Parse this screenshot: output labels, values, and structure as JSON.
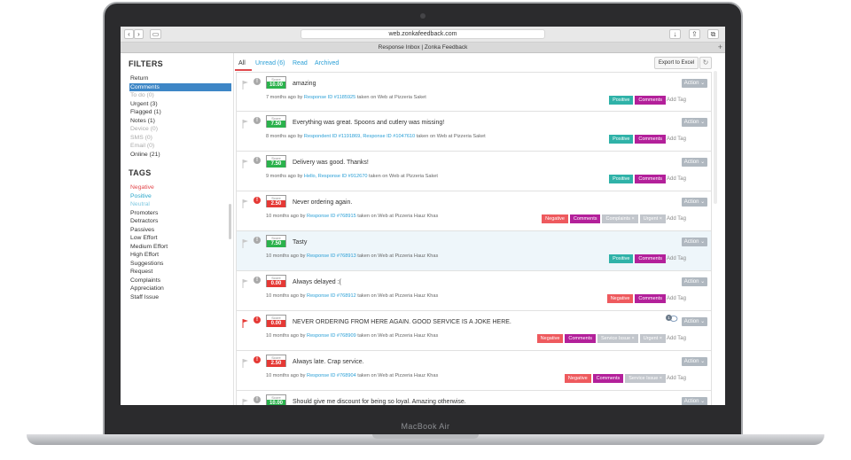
{
  "device": {
    "label": "MacBook Air"
  },
  "browser": {
    "url": "web.zonkafeedback.com",
    "tab_title": "Response Inbox | Zonka Feedback"
  },
  "sidebar": {
    "filters_title": "FILTERS",
    "filters": [
      {
        "label": "Return",
        "state": "normal"
      },
      {
        "label": "Comments",
        "state": "selected"
      },
      {
        "label": "To do (0)",
        "state": "dim"
      },
      {
        "label": "Urgent (3)",
        "state": "normal"
      },
      {
        "label": "Flagged (1)",
        "state": "normal"
      },
      {
        "label": "Notes (1)",
        "state": "normal"
      },
      {
        "label": "Device (0)",
        "state": "dim"
      },
      {
        "label": "SMS (0)",
        "state": "dim"
      },
      {
        "label": "Email (0)",
        "state": "dim"
      },
      {
        "label": "Online (21)",
        "state": "normal"
      }
    ],
    "tags_title": "TAGS",
    "tags": [
      {
        "label": "Negative",
        "state": "neg"
      },
      {
        "label": "Positive",
        "state": "pos"
      },
      {
        "label": "Neutral",
        "state": "neu"
      },
      {
        "label": "Promoters",
        "state": "normal"
      },
      {
        "label": "Detractors",
        "state": "normal"
      },
      {
        "label": "Passives",
        "state": "normal"
      },
      {
        "label": "Low Effort",
        "state": "normal"
      },
      {
        "label": "Medium Effort",
        "state": "normal"
      },
      {
        "label": "High Effort",
        "state": "normal"
      },
      {
        "label": "Suggestions",
        "state": "normal"
      },
      {
        "label": "Request",
        "state": "normal"
      },
      {
        "label": "Complaints",
        "state": "normal"
      },
      {
        "label": "Appreciation",
        "state": "normal"
      },
      {
        "label": "Staff Issue",
        "state": "normal"
      }
    ]
  },
  "tabs": [
    {
      "label": "All",
      "active": true
    },
    {
      "label": "Unread (6)",
      "active": false
    },
    {
      "label": "Read",
      "active": false
    },
    {
      "label": "Archived",
      "active": false
    }
  ],
  "toolbar": {
    "export_label": "Export to Excel"
  },
  "score_label": "Score",
  "action_label": "Action",
  "add_tag_label": "Add Tag",
  "colors": {
    "score_green": "#2bb24c",
    "score_red": "#e53935",
    "alert_red": "#e53935",
    "alert_grey": "#a9a9a9",
    "flag_red": "#e53935",
    "flag_grey": "#c8c8c8"
  },
  "responses": [
    {
      "score": "10.00",
      "score_color": "green",
      "comment": "amazing",
      "time": "7 months ago by",
      "id_label": "Response ID #1185925",
      "source": "taken on Web at Pizzeria Saket",
      "flagged": false,
      "urgent": false,
      "highlight": false,
      "comments_count": "",
      "tags": [
        {
          "label": "Positive",
          "kind": "positive"
        },
        {
          "label": "Comments",
          "kind": "comments"
        }
      ]
    },
    {
      "score": "7.50",
      "score_color": "green",
      "comment": "Everything was great. Spoons and cutlery was missing!",
      "time": "8 months ago by",
      "id_label": "Respondent ID #1191869, Response ID #1047610",
      "source": "taken on Web at Pizzeria Saket",
      "flagged": false,
      "urgent": false,
      "highlight": false,
      "comments_count": "",
      "tags": [
        {
          "label": "Positive",
          "kind": "positive"
        },
        {
          "label": "Comments",
          "kind": "comments"
        }
      ]
    },
    {
      "score": "7.50",
      "score_color": "green",
      "comment": "Delivery was good. Thanks!",
      "time": "9 months ago by",
      "id_label": "Hello, Response ID #912670",
      "source": "taken on Web at Pizzeria Saket",
      "flagged": false,
      "urgent": false,
      "highlight": false,
      "comments_count": "",
      "tags": [
        {
          "label": "Positive",
          "kind": "positive"
        },
        {
          "label": "Comments",
          "kind": "comments"
        }
      ]
    },
    {
      "score": "2.50",
      "score_color": "red",
      "comment": "Never ordering again.",
      "time": "10 months ago by",
      "id_label": "Response ID #768915",
      "source": "taken on Web at Pizzeria Hauz Khas",
      "flagged": false,
      "urgent": true,
      "highlight": false,
      "comments_count": "",
      "tags": [
        {
          "label": "Negative",
          "kind": "negative"
        },
        {
          "label": "Comments",
          "kind": "comments"
        },
        {
          "label": "Complaints ×",
          "kind": "grey"
        },
        {
          "label": "Urgent ×",
          "kind": "grey"
        }
      ]
    },
    {
      "score": "7.50",
      "score_color": "green",
      "comment": "Tasty",
      "time": "10 months ago by",
      "id_label": "Response ID #768913",
      "source": "taken on Web at Pizzeria Hauz Khas",
      "flagged": false,
      "urgent": false,
      "highlight": true,
      "comments_count": "",
      "tags": [
        {
          "label": "Positive",
          "kind": "positive"
        },
        {
          "label": "Comments",
          "kind": "comments"
        }
      ]
    },
    {
      "score": "0.00",
      "score_color": "red",
      "comment": "Always delayed :(",
      "time": "10 months ago by",
      "id_label": "Response ID #768912",
      "source": "taken on Web at Pizzeria Hauz Khas",
      "flagged": false,
      "urgent": false,
      "highlight": false,
      "comments_count": "",
      "tags": [
        {
          "label": "Negative",
          "kind": "negative"
        },
        {
          "label": "Comments",
          "kind": "comments"
        }
      ]
    },
    {
      "score": "0.00",
      "score_color": "red",
      "comment": "NEVER ORDERING FROM HERE AGAIN. GOOD SERVICE IS A JOKE HERE.",
      "time": "10 months ago by",
      "id_label": "Response ID #768909",
      "source": "taken on Web at Pizzeria Hauz Khas",
      "flagged": true,
      "urgent": true,
      "highlight": false,
      "comments_count": "1",
      "tags": [
        {
          "label": "Negative",
          "kind": "negative"
        },
        {
          "label": "Comments",
          "kind": "comments"
        },
        {
          "label": "Service Issue ×",
          "kind": "grey"
        },
        {
          "label": "Urgent ×",
          "kind": "grey"
        }
      ]
    },
    {
      "score": "2.50",
      "score_color": "red",
      "comment": "Always late. Crap service.",
      "time": "10 months ago by",
      "id_label": "Response ID #768904",
      "source": "taken on Web at Pizzeria Hauz Khas",
      "flagged": false,
      "urgent": true,
      "highlight": false,
      "comments_count": "",
      "tags": [
        {
          "label": "Negative",
          "kind": "negative"
        },
        {
          "label": "Comments",
          "kind": "comments"
        },
        {
          "label": "Service Issue ×",
          "kind": "grey"
        }
      ]
    },
    {
      "score": "10.00",
      "score_color": "green",
      "comment": "Should give me discount for being so loyal. Amazing otherwise.",
      "time": "",
      "id_label": "",
      "source": "",
      "flagged": false,
      "urgent": false,
      "highlight": false,
      "comments_count": "",
      "tags": []
    }
  ]
}
